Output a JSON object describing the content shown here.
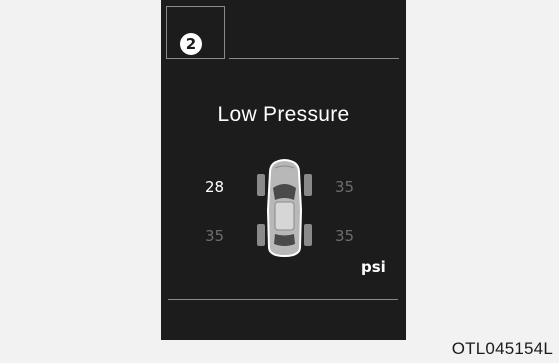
{
  "display": {
    "badge_number": "2",
    "title": "Low Pressure",
    "pressures": {
      "front_left": "28",
      "front_right": "35",
      "rear_left": "35",
      "rear_right": "35"
    },
    "unit": "psi",
    "alert_tire": "front_left"
  },
  "caption": "OTL045154L",
  "icons": [
    "circled-number-icon",
    "car-top-view-icon"
  ],
  "colors": {
    "panel_bg": "#1c1c1c",
    "alert_text": "#ffffff",
    "normal_text": "#6d6d6d",
    "page_bg": "#f2f2f2"
  }
}
